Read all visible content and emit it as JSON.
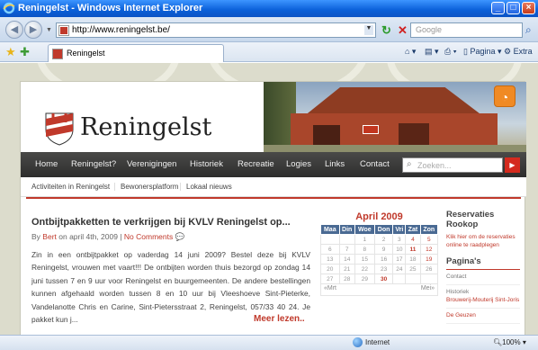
{
  "window": {
    "title": "Reningelst - Windows Internet Explorer",
    "controls": {
      "minimize": "_",
      "maximize": "□",
      "close": "×"
    }
  },
  "navigation": {
    "url": "http://www.reningelst.be/",
    "search_placeholder": "Google",
    "tab_label": "Reningelst",
    "commands": [
      "Pagina",
      "Extra"
    ]
  },
  "site": {
    "name": "Reningelst",
    "menu": [
      "Home",
      "Reningelst?",
      "Verenigingen",
      "Historiek",
      "Recreatie",
      "Logies",
      "Links",
      "Contact"
    ],
    "search_placeholder": "Zoeken...",
    "submenu": [
      "Activiteiten in Reningelst",
      "Bewonersplatform",
      "Lokaal nieuws"
    ]
  },
  "post": {
    "title": "Ontbijtpakketten te verkrijgen bij KVLV Reningelst op...",
    "meta_by": "By",
    "author": "Bert",
    "meta_date": "on april 4th, 2009 |",
    "comments": "No Comments",
    "body": "Zin in een ontbijtpakket op vaderdag 14 juni 2009? Bestel deze bij KVLV Reningelst, vrouwen met vaart!!! De ontbijten worden thuis bezorgd op zondag 14 juni tussen 7 en 9 uur voor Reningelst en buurgemeenten. De andere bestellingen kunnen afgehaald worden tussen 8 en 10 uur bij Vleeshoeve Sint-Pieterke, Vandelanotte Chris en Carine, Sint-Pietersstraat 2, Reningelst, 057/33 40 24. Je pakket kun j...",
    "read_more": "Meer lezen.."
  },
  "calendar": {
    "month": "April 2009",
    "days": [
      "Maa",
      "Din",
      "Woe",
      "Don",
      "Vri",
      "Zat",
      "Zon"
    ],
    "weeks": [
      [
        "",
        "",
        "1",
        "2",
        "3",
        "4",
        "5"
      ],
      [
        "6",
        "7",
        "8",
        "9",
        "10",
        "11",
        "12"
      ],
      [
        "13",
        "14",
        "15",
        "16",
        "17",
        "18",
        "19"
      ],
      [
        "20",
        "21",
        "22",
        "23",
        "24",
        "25",
        "26"
      ],
      [
        "27",
        "28",
        "29",
        "30",
        "",
        "",
        ""
      ]
    ],
    "prev": "«Mrt",
    "next": "Mei»"
  },
  "sidebar": {
    "reservaties_title": "Reservaties Rookop",
    "reservaties_text": "Klik hier om de reservaties online te raadplegen",
    "paginas_title": "Pagina's",
    "pages": [
      "Contact",
      "Historiek",
      "Brouwerij-Mouterij Sint-Joris",
      "De Geuzen"
    ]
  },
  "status": {
    "zone": "Internet",
    "zoom": "100%"
  }
}
